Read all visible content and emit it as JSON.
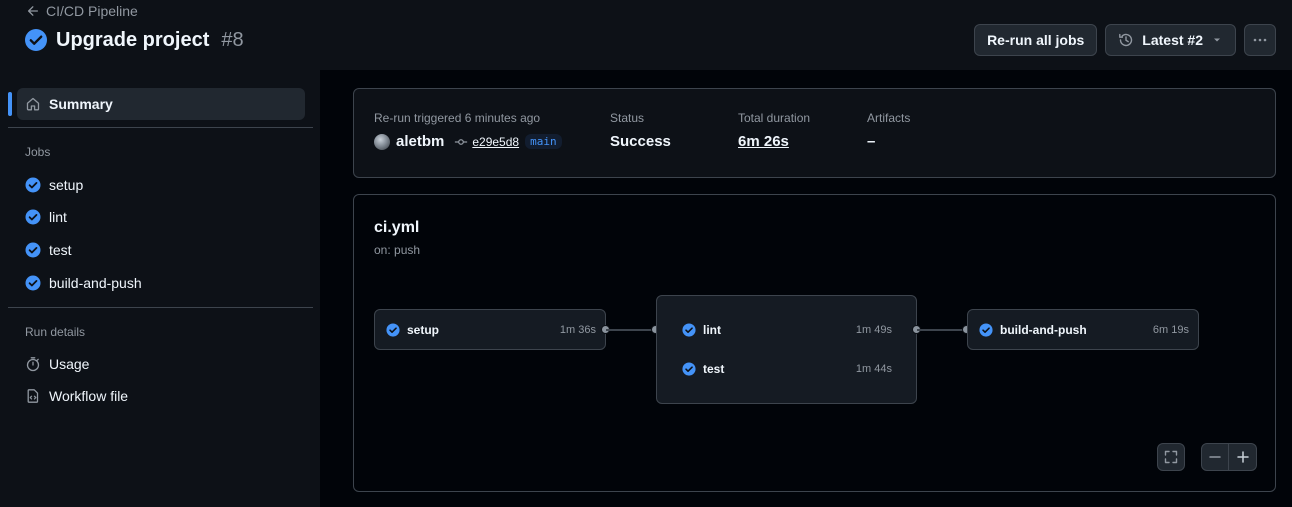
{
  "header": {
    "back_label": "CI/CD Pipeline",
    "title": "Upgrade project",
    "run_number": "#8",
    "rerun_label": "Re-run all jobs",
    "attempt_label": "Latest #2"
  },
  "sidebar": {
    "summary_label": "Summary",
    "jobs_heading": "Jobs",
    "jobs": [
      "setup",
      "lint",
      "test",
      "build-and-push"
    ],
    "run_details_heading": "Run details",
    "usage_label": "Usage",
    "workflow_file_label": "Workflow file"
  },
  "summary": {
    "trigger_label": "Re-run triggered 6 minutes ago",
    "actor": "aletbm",
    "commit": "e29e5d8",
    "branch": "main",
    "status_label": "Status",
    "status_value": "Success",
    "duration_label": "Total duration",
    "duration_value": "6m 26s",
    "artifacts_label": "Artifacts",
    "artifacts_value": "–"
  },
  "graph": {
    "workflow_file": "ci.yml",
    "trigger": "on: push",
    "jobs": [
      {
        "name": "setup",
        "time": "1m 36s"
      },
      {
        "name": "lint",
        "time": "1m 49s"
      },
      {
        "name": "test",
        "time": "1m 44s"
      },
      {
        "name": "build-and-push",
        "time": "6m 19s"
      }
    ]
  },
  "colors": {
    "success": "#4493f8",
    "background": "#010409",
    "panel": "#0d1117",
    "border": "#3d444d"
  }
}
